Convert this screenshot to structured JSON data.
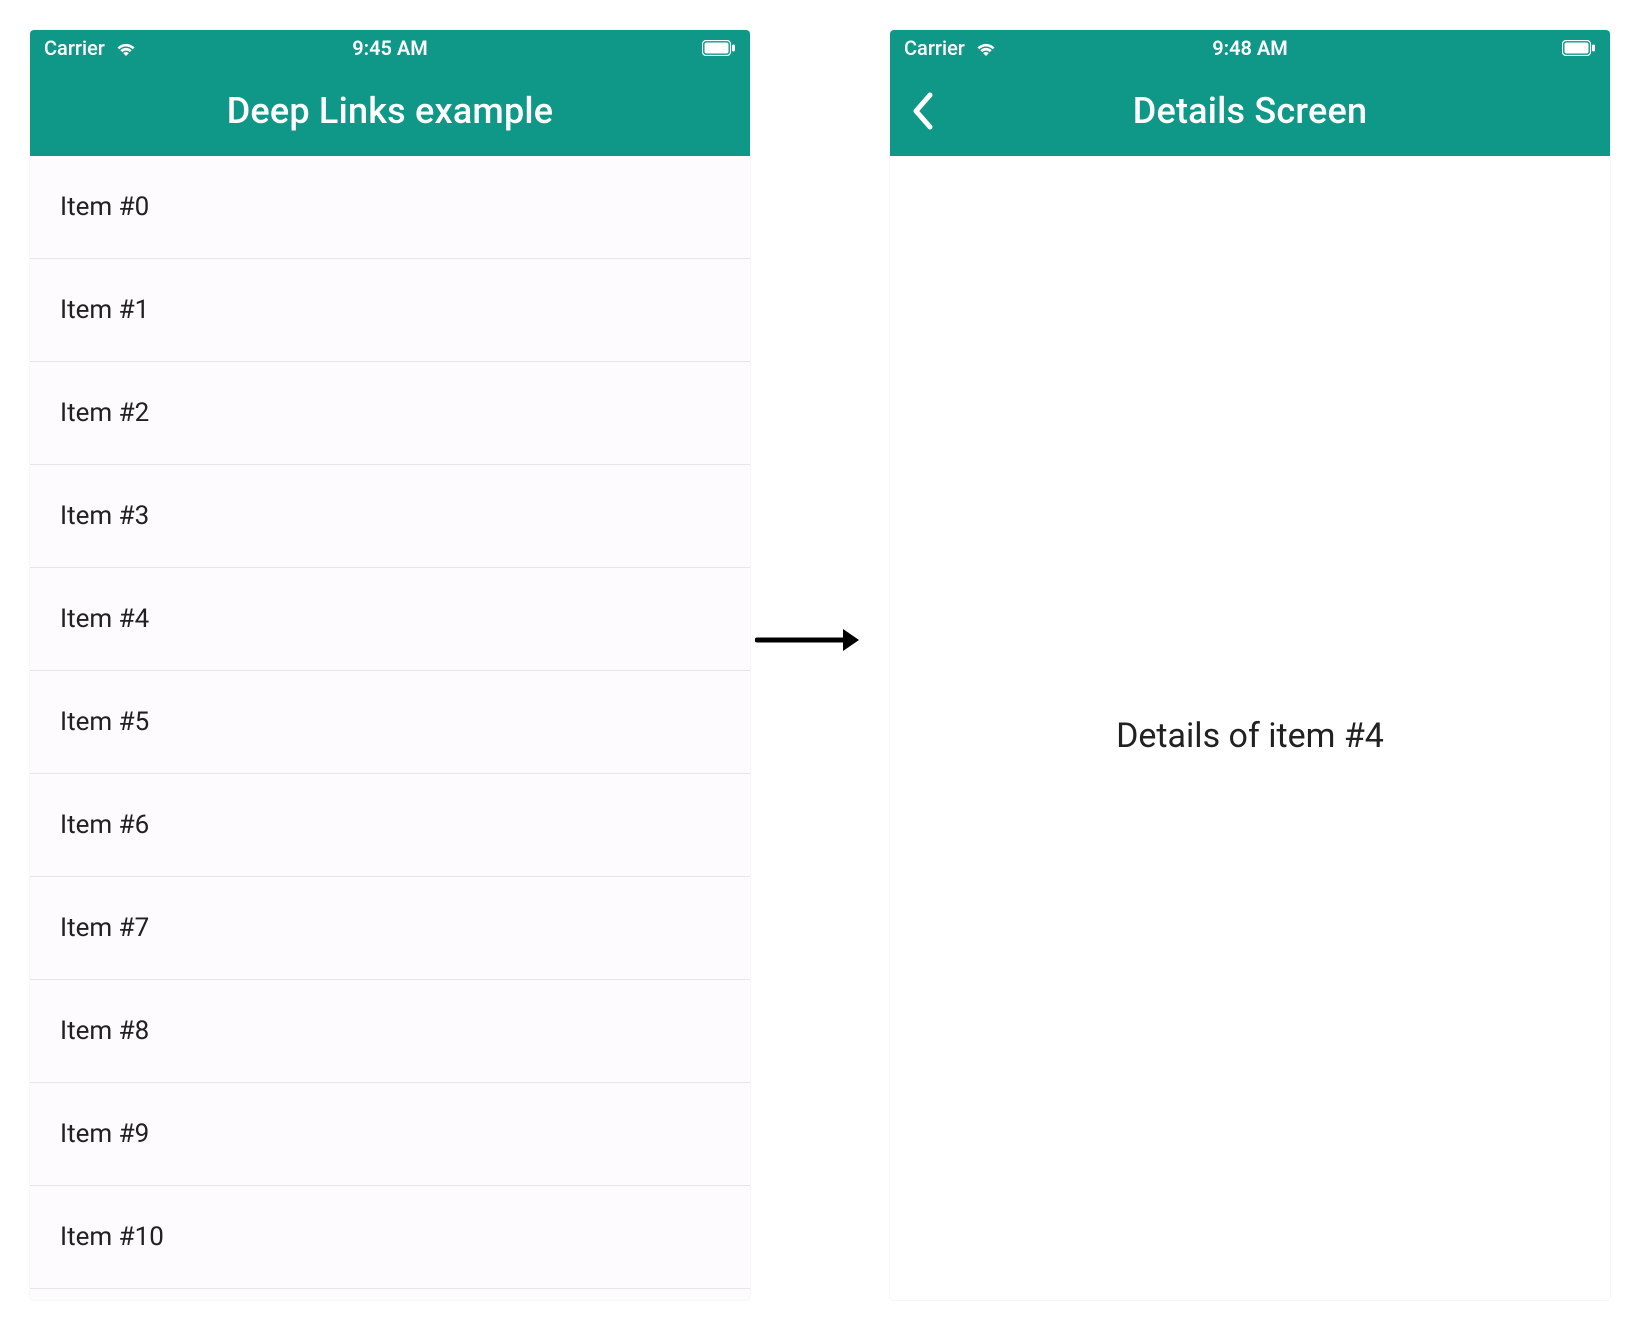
{
  "colors": {
    "accent": "#0f9888"
  },
  "arrow": {
    "label": "navigates-to"
  },
  "left_phone": {
    "statusbar": {
      "carrier": "Carrier",
      "time": "9:45 AM"
    },
    "navbar": {
      "title": "Deep Links example"
    },
    "list": {
      "items": [
        {
          "label": "Item #0"
        },
        {
          "label": "Item #1"
        },
        {
          "label": "Item #2"
        },
        {
          "label": "Item #3"
        },
        {
          "label": "Item #4"
        },
        {
          "label": "Item #5"
        },
        {
          "label": "Item #6"
        },
        {
          "label": "Item #7"
        },
        {
          "label": "Item #8"
        },
        {
          "label": "Item #9"
        },
        {
          "label": "Item #10"
        }
      ]
    }
  },
  "right_phone": {
    "statusbar": {
      "carrier": "Carrier",
      "time": "9:48 AM"
    },
    "navbar": {
      "title": "Details Screen"
    },
    "details": {
      "text": "Details of item #4"
    }
  }
}
